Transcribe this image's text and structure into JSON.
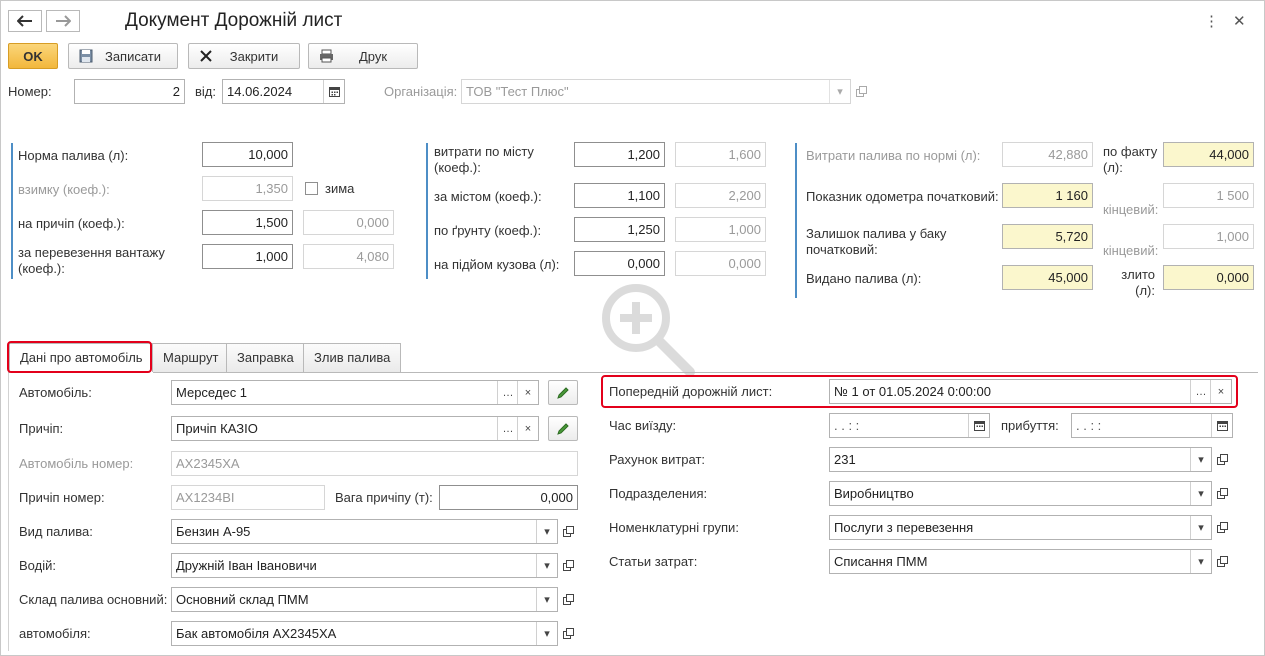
{
  "window": {
    "title": "Документ Дорожній лист"
  },
  "toolbar": {
    "ok": "OK",
    "save": "Записати",
    "close": "Закрити",
    "print": "Друк"
  },
  "header": {
    "number_label": "Номер:",
    "number": "2",
    "from_label": "від:",
    "date": "14.06.2024",
    "org_label": "Організація:",
    "org": "ТОВ \"Тест Плюс\""
  },
  "norms": {
    "fuel_norm_label": "Норма палива (л):",
    "fuel_norm": "10,000",
    "winter_label": "взимку (коеф.):",
    "winter": "1,350",
    "winter_check_label": "зима",
    "trailer_label": "на причіп (коеф.):",
    "trailer": "1,500",
    "trailer_calc": "0,000",
    "cargo_label": "за перевезення вантажу (коеф.):",
    "cargo": "1,000",
    "cargo_calc": "4,080",
    "city_label": "витрати по місту (коеф.):",
    "city": "1,200",
    "city_calc": "1,600",
    "outcity_label": "за містом (коеф.):",
    "outcity": "1,100",
    "outcity_calc": "2,200",
    "ground_label": "по ґрунту (коеф.):",
    "ground": "1,250",
    "ground_calc": "1,000",
    "lift_label": "на підйом кузова (л):",
    "lift": "0,000",
    "lift_calc": "0,000"
  },
  "fuel": {
    "norm_label": "Витрати палива по нормі (л):",
    "norm": "42,880",
    "fact_label": "по факту (л):",
    "fact": "44,000",
    "odo_label": "Показник одометра початковий:",
    "odo_start": "1 160",
    "odo_end_label": "кінцевий:",
    "odo_end": "1 500",
    "tank_label": "Залишок палива у баку початковий:",
    "tank_start": "5,720",
    "tank_end_label": "кінцевий:",
    "tank_end": "1,000",
    "issued_label": "Видано палива (л):",
    "issued": "45,000",
    "drained_label": "злито (л):",
    "drained": "0,000"
  },
  "tabs": [
    {
      "label": "Дані про автомобіль"
    },
    {
      "label": "Маршрут"
    },
    {
      "label": "Заправка"
    },
    {
      "label": "Злив палива"
    }
  ],
  "vehicle": {
    "car_label": "Автомобіль:",
    "car": "Мерседес 1",
    "trailer_label": "Причіп:",
    "trailer": "Причіп КАЗІО",
    "car_number_label": "Автомобіль номер:",
    "car_number": "АХ2345ХА",
    "trailer_number_label": "Причіп номер:",
    "trailer_number": "АХ1234ВІ",
    "trailer_weight_label": "Вага причіпу (т):",
    "trailer_weight": "0,000",
    "fuel_type_label": "Вид палива:",
    "fuel_type": "Бензин А-95",
    "driver_label": "Водій:",
    "driver": "Дружній Іван Івановичи",
    "warehouse_label": "Склад палива основний:",
    "warehouse": "Основний склад ПММ",
    "car_tank_label": "автомобіля:",
    "car_tank": "Бак автомобіля АХ2345ХА"
  },
  "trip": {
    "prev_label": "Попередній дорожній лист:",
    "prev": "№ 1 от 01.05.2024 0:00:00",
    "depart_label": "Час виїзду:",
    "depart": " .  .     :  :",
    "arrive_label": "прибуття:",
    "arrive": " .  .     :  :",
    "account_label": "Рахунок витрат:",
    "account": "231",
    "division_label": "Подразделения:",
    "division": "Виробництво",
    "nomgroup_label": "Номенклатурні групи:",
    "nomgroup": "Послуги з перевезення",
    "costs_label": "Статьи затрат:",
    "costs": "Списання ПММ"
  },
  "colors": {
    "accent": "#f2b73c",
    "highlight": "#e3001b",
    "yellow_field": "#fbf7cd",
    "section_line": "#4d8ec6"
  }
}
